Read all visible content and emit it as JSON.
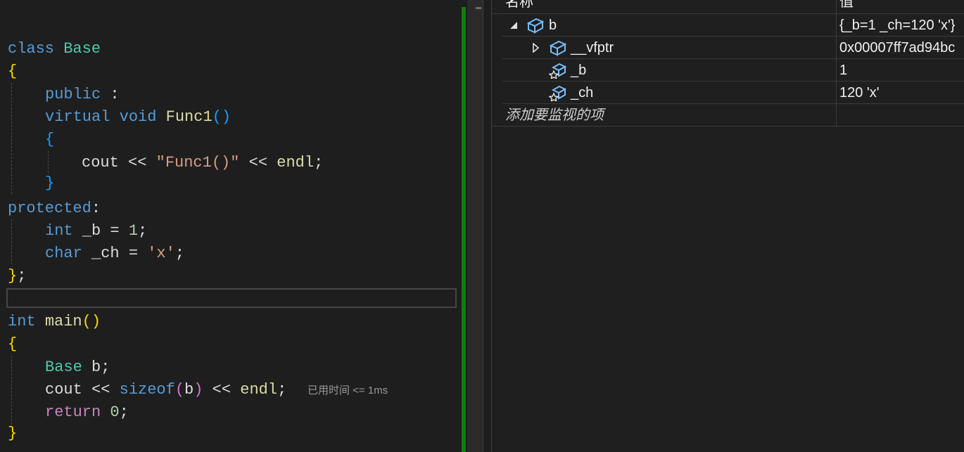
{
  "editor": {
    "code": {
      "l1_kw": "class",
      "l1_name": "Base",
      "l2": "{",
      "l3_kw": "public",
      "l3_rest": " :",
      "l4_kw1": "virtual",
      "l4_kw2": "void",
      "l4_fn": "Func1",
      "l4_paren": "()",
      "l5": "{",
      "l6_a": "cout",
      "l6_op1": " << ",
      "l6_str": "\"Func1()\"",
      "l6_op2": " << ",
      "l6_b": "endl",
      "l6_semi": ";",
      "l7": "}",
      "l8_kw": "protected",
      "l8_colon": ":",
      "l9_kw": "int",
      "l9_rest": " _b = ",
      "l9_num": "1",
      "l9_semi": ";",
      "l10_kw": "char",
      "l10_rest": " _ch = ",
      "l10_str": "'x'",
      "l10_semi": ";",
      "l11_brace": "}",
      "l11_semi": ";",
      "l13_kw": "int",
      "l13_fn": "main",
      "l13_paren": "()",
      "l14": "{",
      "l15_ty": "Base",
      "l15_rest": " b;",
      "l16_a": "cout",
      "l16_op1": " << ",
      "l16_kw": "sizeof",
      "l16_p1": "(",
      "l16_b": "b",
      "l16_p2": ")",
      "l16_op2": " << ",
      "l16_c": "endl",
      "l16_semi": ";",
      "l17_kw": "return",
      "l17_rest": " ",
      "l17_num": "0",
      "l17_semi": ";",
      "l18": "}"
    },
    "perf_tip": "已用时间 <= 1ms"
  },
  "watch": {
    "header": {
      "name_col": "名称",
      "value_col": "值"
    },
    "rows": [
      {
        "name": "b",
        "value": "{_b=1 _ch=120 'x'}",
        "icon": "class-object-icon",
        "expander": "expanded"
      },
      {
        "name": "__vfptr",
        "value": "0x00007ff7ad94bc",
        "icon": "class-object-icon",
        "expander": "collapsed"
      },
      {
        "name": "_b",
        "value": "1",
        "icon": "protected-field-icon"
      },
      {
        "name": "_ch",
        "value": "120 'x'",
        "icon": "protected-field-icon"
      }
    ],
    "add_placeholder": "添加要监视的项"
  },
  "colors": {
    "background": "#1e1e1e",
    "keyword": "#569cd6",
    "type": "#4ec9b0",
    "function": "#dcdcaa",
    "string": "#d69d85",
    "number": "#b5cea8",
    "control": "#c586c0",
    "change_bar": "#107c10"
  }
}
